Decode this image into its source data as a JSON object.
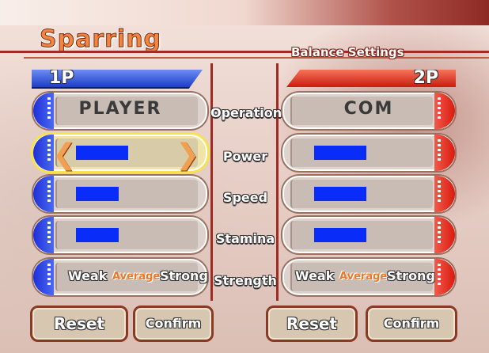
{
  "screen": {
    "title": "Sparring",
    "subtitle": "Balance Settings"
  },
  "players": {
    "p1": {
      "label": "1P",
      "controller": "PLAYER",
      "power": 0.55,
      "speed": 0.45,
      "stamina": 0.45,
      "strength_selected": "Average"
    },
    "p2": {
      "label": "2P",
      "controller": "COM",
      "power": 0.55,
      "speed": 0.55,
      "stamina": 0.55,
      "strength_selected": "Average"
    }
  },
  "rows": {
    "operation": "Operation",
    "power": "Power",
    "speed": "Speed",
    "stamina": "Stamina",
    "strength": "Strength"
  },
  "strength_options": [
    "Weak",
    "Average",
    "Strong"
  ],
  "buttons": {
    "reset": "Reset",
    "confirm": "Confirm"
  },
  "colors": {
    "p1_accent": "#1f2fd8",
    "p2_accent": "#d81b10",
    "bar": "#0a2cf8",
    "title": "#f28640",
    "selected_option": "#e8782a",
    "selection_highlight": "#f6e24e"
  },
  "selection": {
    "player": "1P",
    "row": "Power"
  }
}
